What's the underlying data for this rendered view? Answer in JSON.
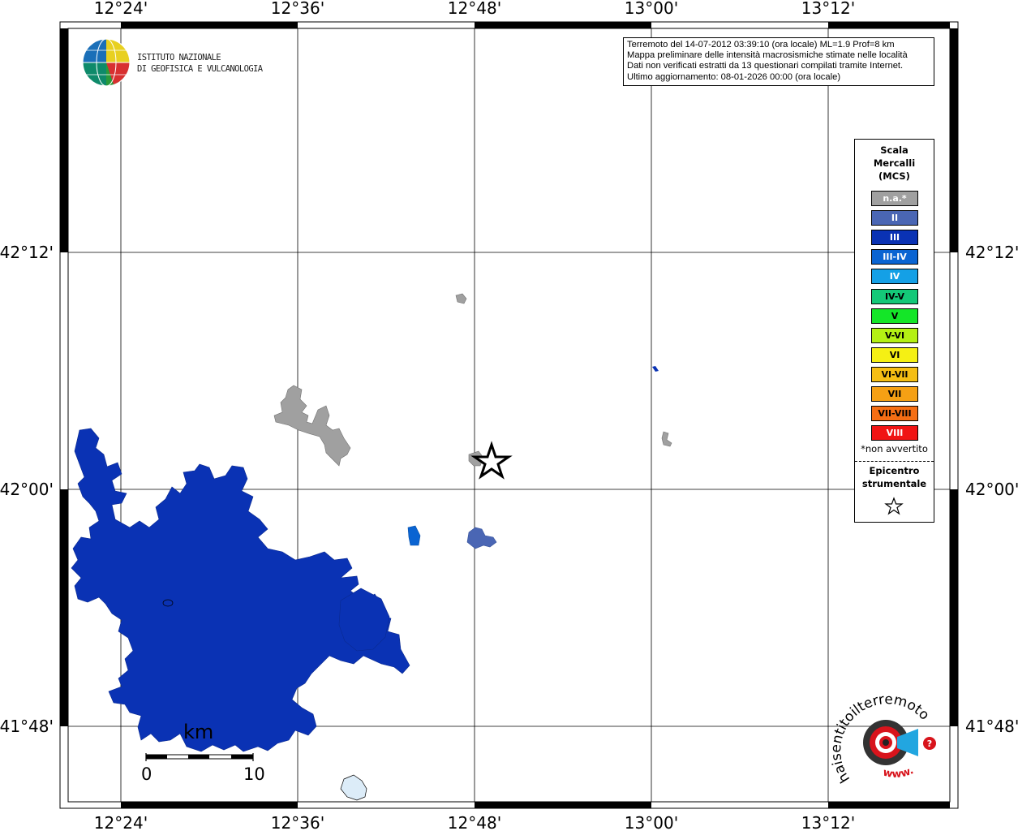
{
  "map": {
    "top_longitude_labels": [
      "12°24'",
      "12°36'",
      "12°48'",
      "13°00'",
      "13°12'"
    ],
    "bottom_longitude_labels": [
      "12°24'",
      "12°36'",
      "12°48'",
      "13°00'",
      "13°12'"
    ],
    "left_latitude_labels": [
      "42°12'",
      "42°00'",
      "41°48'"
    ],
    "right_latitude_labels": [
      "42°12'",
      "42°00'",
      "41°48'"
    ]
  },
  "logo": {
    "line1": "ISTITUTO NAZIONALE",
    "line2": "DI GEOFISICA E VULCANOLOGIA"
  },
  "info": {
    "line1": "Terremoto del 14-07-2012 03:39:10 (ora locale) ML=1.9 Prof=8 km",
    "line2": "Mappa preliminare delle intensità macrosismiche stimate nelle località",
    "line3": "Dati non verificati estratti da 13 questionari compilati tramite Internet.",
    "line4": "Ultimo aggiornamento: 08-01-2026 00:00 (ora locale)"
  },
  "legend": {
    "title_line1": "Scala",
    "title_line2": "Mercalli",
    "title_line3": "(MCS)",
    "items": [
      {
        "label": "n.a.*",
        "color": "#a0a0a0",
        "text_color": "#ffffff"
      },
      {
        "label": "II",
        "color": "#4a66b4",
        "text_color": "#ffffff"
      },
      {
        "label": "III",
        "color": "#0a32b4",
        "text_color": "#ffffff"
      },
      {
        "label": "III-IV",
        "color": "#0a64d2",
        "text_color": "#ffffff"
      },
      {
        "label": "IV",
        "color": "#14a0e6",
        "text_color": "#ffffff"
      },
      {
        "label": "IV-V",
        "color": "#14c878",
        "text_color": "#000000"
      },
      {
        "label": "V",
        "color": "#14e628",
        "text_color": "#000000"
      },
      {
        "label": "V-VI",
        "color": "#b4f014",
        "text_color": "#000000"
      },
      {
        "label": "VI",
        "color": "#f5f014",
        "text_color": "#000000"
      },
      {
        "label": "VI-VII",
        "color": "#f5be14",
        "text_color": "#000000"
      },
      {
        "label": "VII",
        "color": "#f5a014",
        "text_color": "#000000"
      },
      {
        "label": "VII-VIII",
        "color": "#f56e14",
        "text_color": "#000000"
      },
      {
        "label": "VIII",
        "color": "#f01414",
        "text_color": "#ffffff"
      }
    ],
    "note": "*non avvertito",
    "epicenter_line1": "Epicentro",
    "epicenter_line2": "strumentale"
  },
  "scalebar": {
    "unit": "km",
    "start": "0",
    "end": "10"
  },
  "badge": {
    "text": "haisentitoilterremoto.it",
    "www": "www."
  },
  "colors": {
    "intensity_III": "#0a32b4",
    "intensity_II": "#4a66b4",
    "intensity_III_IV": "#0a64d2",
    "not_felt": "#a0a0a0"
  }
}
